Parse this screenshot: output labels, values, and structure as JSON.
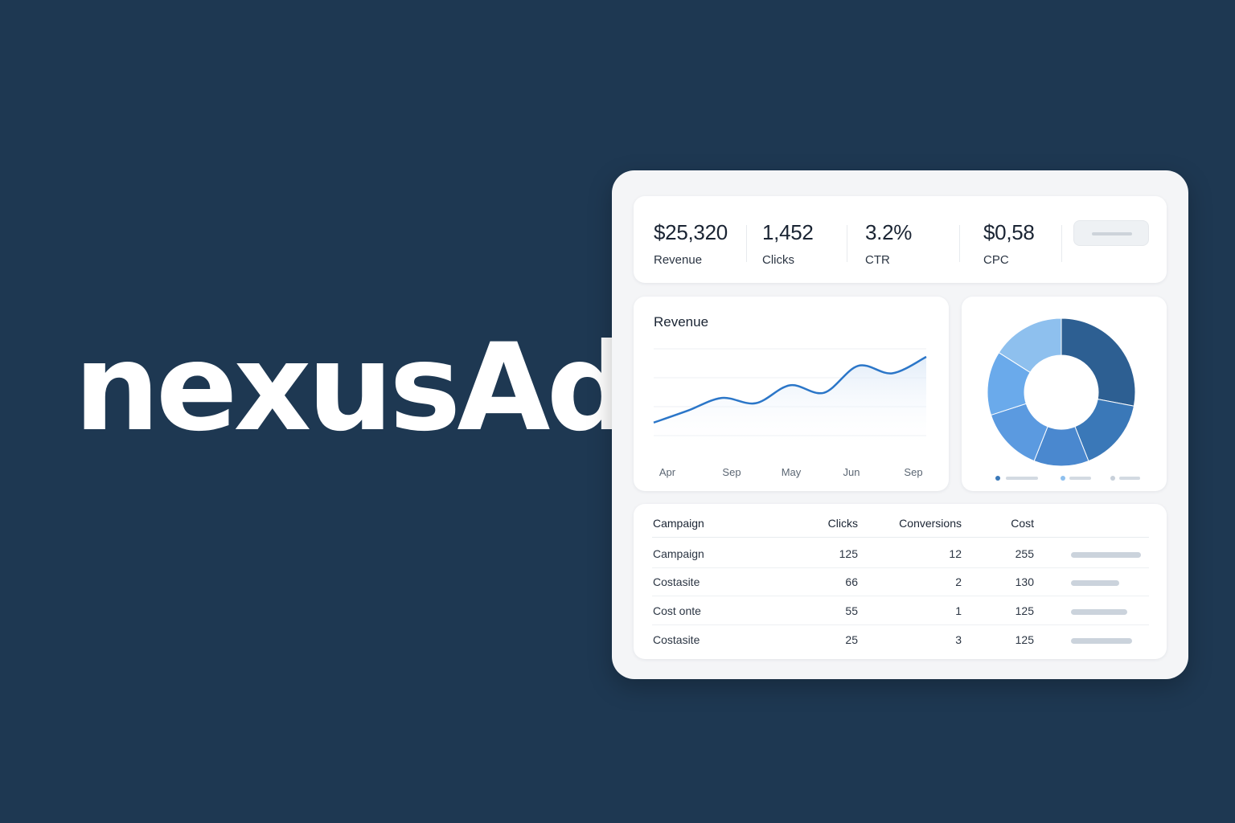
{
  "brand": {
    "name": "nexusAd"
  },
  "kpis": [
    {
      "value": "$25,320",
      "label": "Revenue"
    },
    {
      "value": "1,452",
      "label": "Clicks"
    },
    {
      "value": "3.2%",
      "label": "CTR"
    },
    {
      "value": "$0,58",
      "label": "CPC"
    }
  ],
  "revenue_chart": {
    "title": "Revenue",
    "x_labels": [
      "Apr",
      "Sep",
      "May",
      "Jun",
      "Sep"
    ]
  },
  "table": {
    "headers": {
      "campaign": "Campaign",
      "clicks": "Clicks",
      "conversions": "Conversions",
      "cost": "Cost"
    },
    "rows": [
      {
        "campaign": "Campaign",
        "clicks": "125",
        "conversions": "12",
        "cost": "255",
        "bar_fraction": 1.0
      },
      {
        "campaign": "Costasite",
        "clicks": "66",
        "conversions": "2",
        "cost": "130",
        "bar_fraction": 0.69
      },
      {
        "campaign": "Cost onte",
        "clicks": "55",
        "conversions": "1",
        "cost": "125",
        "bar_fraction": 0.8
      },
      {
        "campaign": "Costasite",
        "clicks": "25",
        "conversions": "3",
        "cost": "125",
        "bar_fraction": 0.87
      }
    ]
  },
  "colors": {
    "background": "#1e3852",
    "line": "#2b76c8",
    "donut": [
      "#2d5f92",
      "#3a78b8",
      "#4a88cf",
      "#5b9ae0",
      "#6aaaeb",
      "#8ec0ee"
    ]
  },
  "chart_data": [
    {
      "type": "line",
      "title": "Revenue",
      "x": [
        "Apr",
        "",
        "Sep",
        "",
        "May",
        "",
        "Jun",
        "",
        "Sep"
      ],
      "series": [
        {
          "values": [
            0.12,
            0.28,
            0.45,
            0.38,
            0.62,
            0.52,
            0.88,
            0.78,
            1.0
          ]
        }
      ],
      "grid": true
    },
    {
      "type": "pie",
      "donut": true,
      "slices": [
        28,
        16,
        12,
        14,
        14,
        16
      ]
    }
  ]
}
